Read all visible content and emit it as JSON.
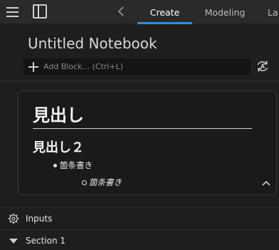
{
  "toolbar": {
    "tabs": [
      {
        "label": "Create",
        "active": true
      },
      {
        "label": "Modeling",
        "active": false
      },
      {
        "label": "La",
        "active": false
      }
    ],
    "accent_color": "#3b8ad9"
  },
  "notebook": {
    "title": "Untitled Notebook",
    "add_block_placeholder": "Add Block... (Ctrl+L)"
  },
  "text_block": {
    "heading1": "見出し",
    "heading2": "見出し２",
    "bullet_level1": "箇条書き",
    "bullet_level2": "箇条書き"
  },
  "sections": [
    {
      "label": "Inputs",
      "icon": "gear-icon"
    },
    {
      "label": "Section 1",
      "icon": "triangle-down-icon"
    }
  ]
}
